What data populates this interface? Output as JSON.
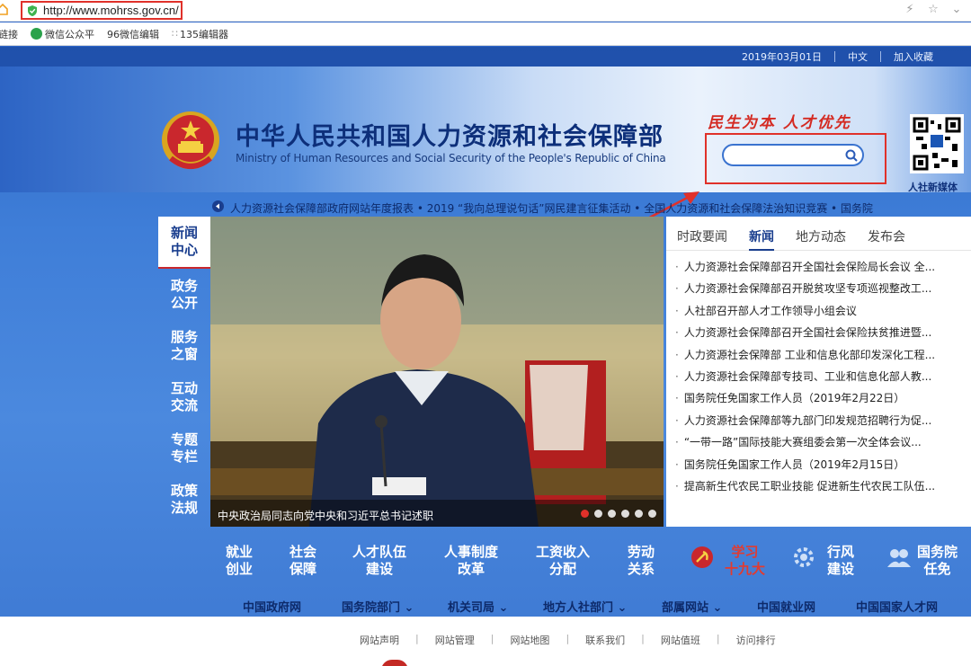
{
  "browser": {
    "url": "http://www.mohrss.gov.cn/",
    "bookmarks": [
      {
        "label": "链接"
      },
      {
        "label": "微信公众平"
      },
      {
        "label": "96微信编辑"
      },
      {
        "label": "135编辑器"
      }
    ]
  },
  "topbar": {
    "date": "2019年03月01日",
    "lang": "中文",
    "favorite": "加入收藏"
  },
  "header": {
    "title_cn": "中华人民共和国人力资源和社会保障部",
    "title_en": "Ministry of Human Resources and Social Security of the People's Republic of China",
    "slogan": "民生为本 人才优先",
    "search_placeholder": "",
    "qr_label": "人社新媒体"
  },
  "ticker": {
    "text": "人力资源社会保障部政府网站年度报表  • 2019 “我向总理说句话”网民建言征集活动  • 全国人力资源和社会保障法治知识竞赛  • 国务院"
  },
  "left_nav": [
    {
      "line1": "新闻",
      "line2": "中心"
    },
    {
      "line1": "政务",
      "line2": "公开"
    },
    {
      "line1": "服务",
      "line2": "之窗"
    },
    {
      "line1": "互动",
      "line2": "交流"
    },
    {
      "line1": "专题",
      "line2": "专栏"
    },
    {
      "line1": "政策",
      "line2": "法规"
    }
  ],
  "slideshow": {
    "caption": "中央政治局同志向党中央和习近平总书记述职"
  },
  "news": {
    "tabs": [
      "时政要闻",
      "新闻",
      "地方动态",
      "发布会"
    ],
    "items": [
      "人力资源社会保障部召开全国社会保险局长会议 全...",
      "人力资源社会保障部召开脱贫攻坚专项巡视整改工...",
      "人社部召开部人才工作领导小组会议",
      "人力资源社会保障部召开全国社会保险扶贫推进暨...",
      "人力资源社会保障部 工业和信息化部印发深化工程...",
      "人力资源社会保障部专技司、工业和信息化部人教...",
      "国务院任免国家工作人员（2019年2月22日）",
      "人力资源社会保障部等九部门印发规范招聘行为促...",
      "“一带一路”国际技能大赛组委会第一次全体会议...",
      "国务院任免国家工作人员（2019年2月15日）",
      "提高新生代农民工职业技能 促进新生代农民工队伍..."
    ]
  },
  "bottom_nav": [
    {
      "line1": "就业",
      "line2": "创业"
    },
    {
      "line1": "社会",
      "line2": "保障"
    },
    {
      "line1": "人才队伍",
      "line2": "建设"
    },
    {
      "line1": "人事制度",
      "line2": "改革"
    },
    {
      "line1": "工资收入",
      "line2": "分配"
    },
    {
      "line1": "劳动",
      "line2": "关系"
    },
    {
      "line1": "学习",
      "line2": "十九大"
    },
    {
      "line1": "行风",
      "line2": "建设"
    },
    {
      "line1": "国务院",
      "line2": "任免"
    }
  ],
  "links": [
    "中国政府网",
    "国务院部门",
    "机关司局",
    "地方人社部门",
    "部属网站",
    "中国就业网",
    "中国国家人才网"
  ],
  "footer": {
    "links": [
      "网站声明",
      "网站管理",
      "网站地图",
      "联系我们",
      "网站值班",
      "访问排行"
    ]
  },
  "colors": {
    "accent_red": "#e0312a",
    "brand_blue": "#1a3e8e"
  }
}
